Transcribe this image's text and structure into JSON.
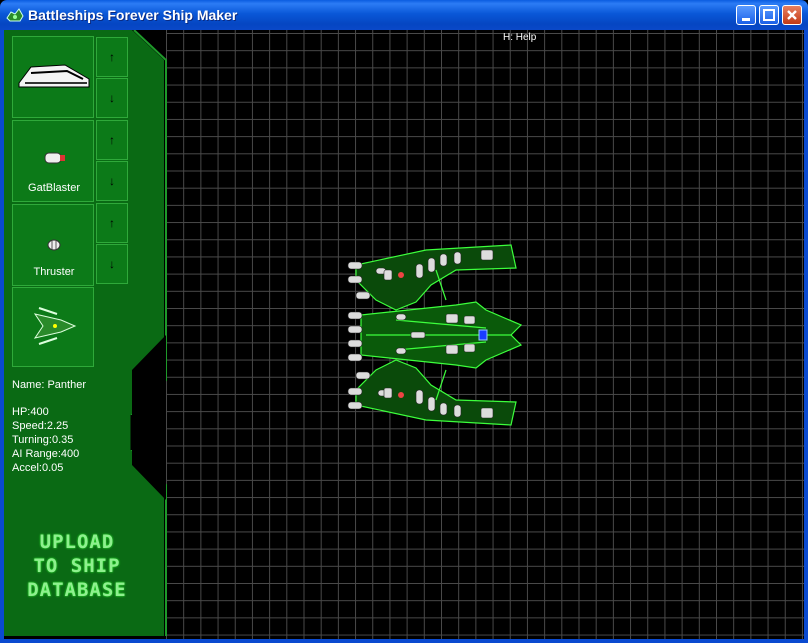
{
  "window": {
    "title": "Battleships Forever Ship Maker",
    "icon": "ship-app-icon"
  },
  "colors": {
    "panel_green": "#0c7a18",
    "panel_dark": "#0a6a14",
    "ship_outline": "#3cff3c",
    "grid": "#4a4a4a"
  },
  "palette": {
    "slots": [
      {
        "label": "",
        "icon": "hull-icon"
      },
      {
        "label": "GatBlaster",
        "icon": "gatblaster-icon"
      },
      {
        "label": "Thruster",
        "icon": "thruster-icon"
      },
      {
        "label": "",
        "icon": "ship-preview-icon"
      }
    ],
    "arrow_up": "↑",
    "arrow_down": "↓"
  },
  "ship": {
    "name_line": "Name: Panther",
    "hp": "HP:400",
    "speed": "Speed:2.25",
    "turning": "Turning:0.35",
    "ai_range": "AI Range:400",
    "accel": "Accel:0.05"
  },
  "upload": {
    "line1": "UPLOAD",
    "line2": "TO SHIP",
    "line3": "DATABASE"
  },
  "help": "H: Help"
}
